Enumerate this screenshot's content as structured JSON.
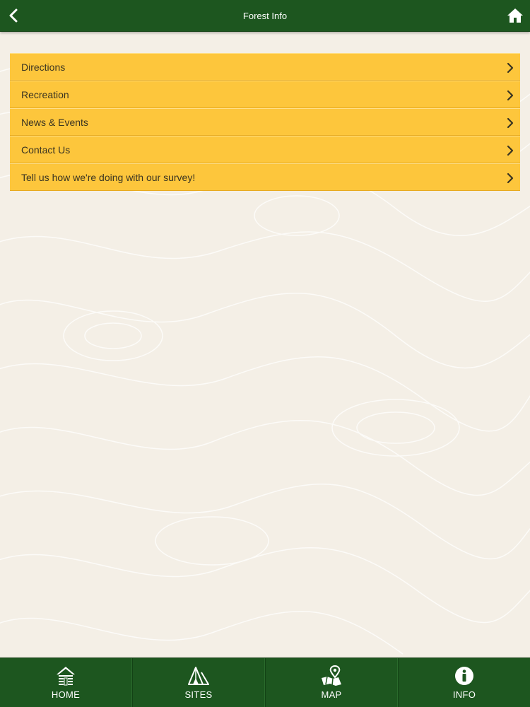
{
  "header": {
    "title": "Forest Info",
    "back_icon": "chevron-left-icon",
    "home_icon": "home-icon"
  },
  "menu": {
    "items": [
      {
        "label": "Directions"
      },
      {
        "label": "Recreation"
      },
      {
        "label": "News & Events"
      },
      {
        "label": "Contact Us"
      },
      {
        "label": "Tell us how we're doing with our survey!"
      }
    ]
  },
  "tabbar": {
    "tabs": [
      {
        "label": "HOME",
        "icon": "cabin-icon"
      },
      {
        "label": "SITES",
        "icon": "tent-icon"
      },
      {
        "label": "MAP",
        "icon": "map-pin-icon"
      },
      {
        "label": "INFO",
        "icon": "info-icon"
      }
    ]
  },
  "colors": {
    "header_bg": "#1d561f",
    "menu_bg": "#fdc63c",
    "page_bg": "#f4efe6",
    "text_light": "#ffffff",
    "menu_text": "#3a3422"
  }
}
